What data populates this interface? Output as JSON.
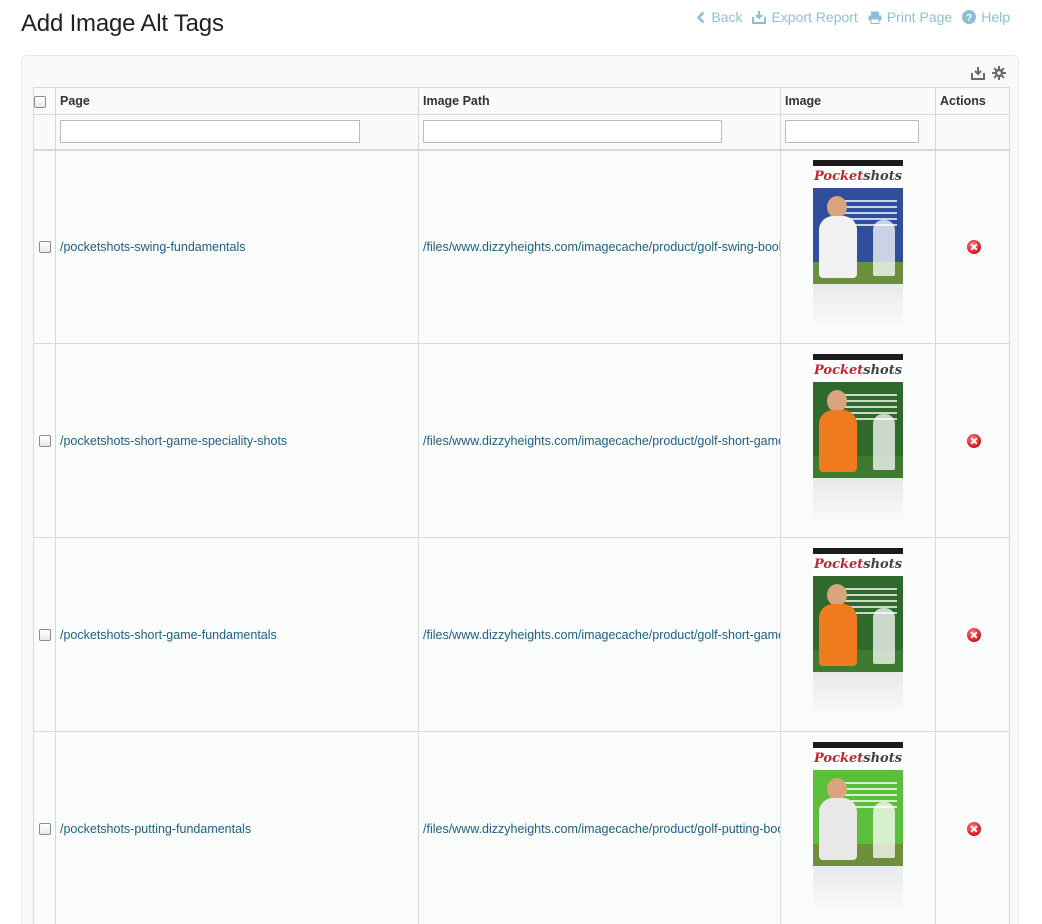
{
  "page": {
    "title": "Add Image Alt Tags"
  },
  "top_actions": {
    "back": "Back",
    "export": "Export Report",
    "print": "Print Page",
    "help": "Help"
  },
  "panel_tools": [
    "export-icon",
    "gear-icon"
  ],
  "table": {
    "columns": {
      "page": "Page",
      "image_path": "Image Path",
      "image": "Image",
      "actions": "Actions"
    },
    "filters": {
      "page": "",
      "image_path": "",
      "image": ""
    },
    "rows": [
      {
        "page": "/pocketshots-swing-fundamentals",
        "image_path": "/files/www.dizzyheights.com/imagecache/product/golf-swing-book",
        "cover_color": "#2f4e9b",
        "ground_color": "#6b8f3a",
        "shirt_color": "#f2f2f2"
      },
      {
        "page": "/pocketshots-short-game-speciality-shots",
        "image_path": "/files/www.dizzyheights.com/imagecache/product/golf-short-game",
        "cover_color": "#2f6a2c",
        "ground_color": "#3e7a2f",
        "shirt_color": "#f07a1e"
      },
      {
        "page": "/pocketshots-short-game-fundamentals",
        "image_path": "/files/www.dizzyheights.com/imagecache/product/golf-short-game",
        "cover_color": "#2f6a2c",
        "ground_color": "#3e7a2f",
        "shirt_color": "#f07a1e"
      },
      {
        "page": "/pocketshots-putting-fundamentals",
        "image_path": "/files/www.dizzyheights.com/imagecache/product/golf-putting-book",
        "cover_color": "#5cbf3a",
        "ground_color": "#6f8f3c",
        "shirt_color": "#e8e8e8"
      }
    ],
    "cover_brand_a": "Pocket",
    "cover_brand_b": "shots"
  },
  "colors": {
    "link": "#1d5f86",
    "top_action": "#8bbfd8",
    "delete": "#d0141c"
  }
}
